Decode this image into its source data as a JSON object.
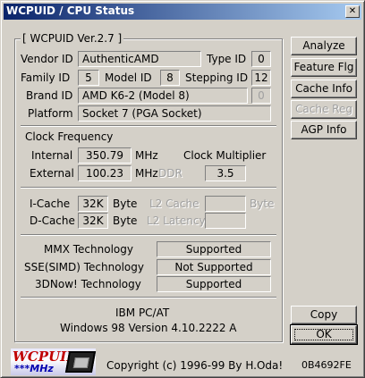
{
  "window": {
    "title": "WCPUID / CPU Status",
    "close_glyph": "✕"
  },
  "main_group": {
    "title": "[ WCPUID Ver.2.7 ]"
  },
  "cpu": {
    "vendor_id_label": "Vendor ID",
    "vendor_id_value": "AuthenticAMD",
    "type_id_label": "Type ID",
    "type_id_value": "0",
    "family_id_label": "Family ID",
    "family_id_value": "5",
    "model_id_label": "Model ID",
    "model_id_value": "8",
    "stepping_id_label": "Stepping ID",
    "stepping_id_value": "12",
    "brand_id_label": "Brand ID",
    "brand_id_value": "AMD K6-2 (Model 8)",
    "brand_id_index": "0",
    "platform_label": "Platform",
    "platform_value": "Socket 7   (PGA Socket)"
  },
  "clock": {
    "heading": "Clock Frequency",
    "internal_label": "Internal",
    "internal_value": "350.79",
    "internal_unit": "MHz",
    "multiplier_label": "Clock Multiplier",
    "external_label": "External",
    "external_value": "100.23",
    "external_unit": "MHz",
    "ddr_label": "DDR",
    "multiplier_value": "3.5"
  },
  "cache": {
    "icache_label": "I-Cache",
    "icache_value": "32K",
    "icache_unit": "Byte",
    "dcache_label": "D-Cache",
    "dcache_value": "32K",
    "dcache_unit": "Byte",
    "l2_cache_label": "L2 Cache",
    "l2_cache_value": "",
    "l2_cache_unit": "Byte",
    "l2_latency_label": "L2 Latency",
    "l2_latency_value": ""
  },
  "features": [
    {
      "label": "MMX Technology",
      "value": "Supported"
    },
    {
      "label": "SSE(SIMD) Technology",
      "value": "Not Supported"
    },
    {
      "label": "3DNow! Technology",
      "value": "Supported"
    }
  ],
  "system": {
    "machine": "IBM PC/AT",
    "os": "Windows 98  Version 4.10.2222 A"
  },
  "buttons": {
    "analyze": "Analyze",
    "feature_flg": "Feature Flg",
    "cache_info": "Cache Info",
    "cache_reg": "Cache Reg",
    "agp_info": "AGP Info",
    "copy": "Copy",
    "ok": "OK"
  },
  "footer": {
    "logo_text": "WCPUID",
    "logo_sub": "***MHz",
    "copyright": "Copyright (c) 1996-99  By H.Oda!",
    "code": "0B4692FE"
  }
}
